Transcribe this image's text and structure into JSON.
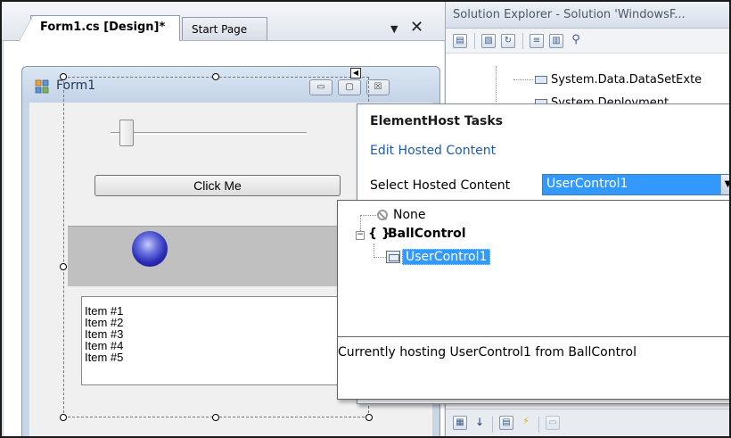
{
  "doc_tabs": [
    {
      "label": "Form1.cs [Design]*",
      "active": true
    },
    {
      "label": "Start Page",
      "active": false
    }
  ],
  "doc_tab_controls": {
    "dropdown": "▼",
    "close": "✕"
  },
  "form": {
    "title": "Form1",
    "caption_buttons": {
      "minimize": "▭",
      "maximize": "▢",
      "close": "☒"
    },
    "button_label": "Click Me",
    "list_items": [
      "Item #1",
      "Item #2",
      "Item #3",
      "Item #4",
      "Item #5"
    ],
    "trackbar_value": 0
  },
  "solution_explorer": {
    "title": "Solution Explorer - Solution 'WindowsF...",
    "tree_items": [
      "System.Data.DataSetExte",
      "System.Deployment"
    ]
  },
  "element_host_tasks": {
    "title": "ElementHost Tasks",
    "edit_link": "Edit Hosted Content",
    "select_label": "Select Hosted Content",
    "selected_value": "UserControl1"
  },
  "dropdown": {
    "tree": [
      {
        "label": "None",
        "icon": "none-icon"
      },
      {
        "label": "BallControl",
        "icon": "braces-icon",
        "prefix": "{ }",
        "expanded": true,
        "expander": "−"
      },
      {
        "label": "UserControl1",
        "icon": "user-control-icon",
        "selected": true
      }
    ],
    "status": "Currently hosting UserControl1 from BallControl"
  },
  "colors": {
    "selection_blue": "#3399ff",
    "link_blue": "#1e5ca8",
    "panel_gray": "#c0c0c0",
    "ball_blue": "#2c2fb8"
  }
}
